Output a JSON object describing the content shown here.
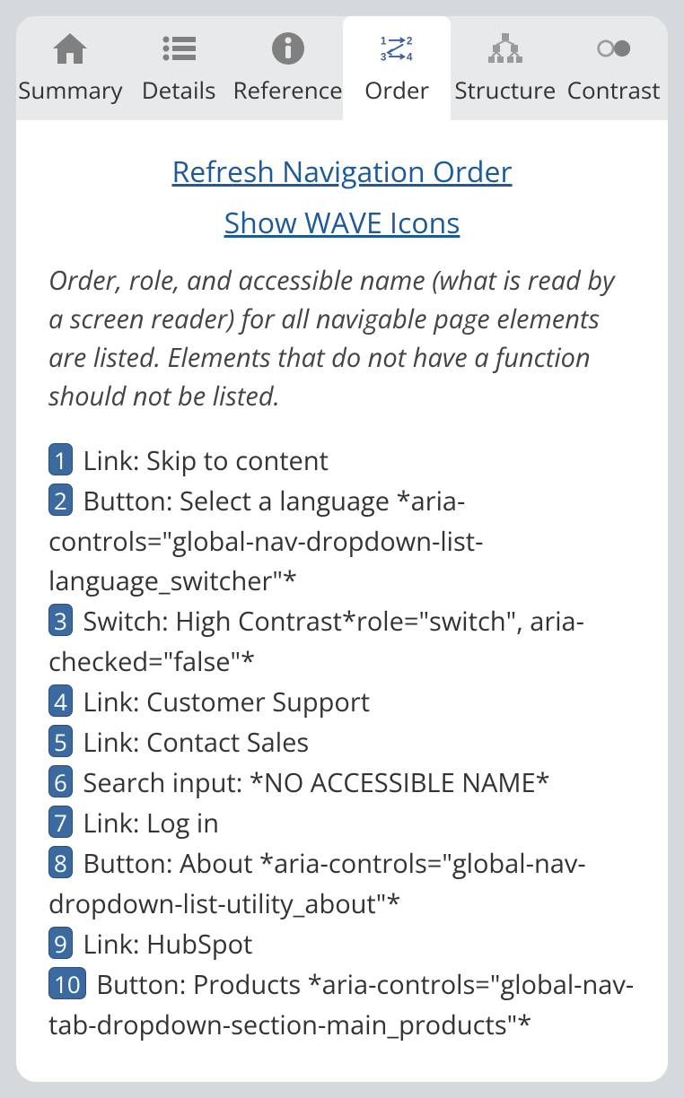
{
  "tabs": [
    {
      "id": "summary",
      "label": "Summary"
    },
    {
      "id": "details",
      "label": "Details"
    },
    {
      "id": "reference",
      "label": "Reference"
    },
    {
      "id": "order",
      "label": "Order"
    },
    {
      "id": "structure",
      "label": "Structure"
    },
    {
      "id": "contrast",
      "label": "Contrast"
    }
  ],
  "active_tab": "order",
  "links": {
    "refresh": "Refresh Navigation Order",
    "showIcons": "Show WAVE Icons"
  },
  "description": "Order, role, and accessible name (what is read by a screen reader) for all navigable page elements are listed. Elements that do not have a function should not be listed.",
  "order": [
    {
      "n": "1",
      "text": "Link: Skip to content"
    },
    {
      "n": "2",
      "text": "Button: Select a language *aria-controls=\"global-nav-dropdown-list-language_switcher\"*"
    },
    {
      "n": "3",
      "text": "Switch: High Contrast*role=\"switch\", aria-checked=\"false\"*"
    },
    {
      "n": "4",
      "text": "Link: Customer Support"
    },
    {
      "n": "5",
      "text": "Link: Contact Sales"
    },
    {
      "n": "6",
      "text": "Search input: *NO ACCESSIBLE NAME*"
    },
    {
      "n": "7",
      "text": "Link: Log in"
    },
    {
      "n": "8",
      "text": "Button: About *aria-controls=\"global-nav-dropdown-list-utility_about\"*"
    },
    {
      "n": "9",
      "text": "Link: HubSpot"
    },
    {
      "n": "10",
      "text": "Button: Products *aria-controls=\"global-nav-tab-dropdown-section-main_products\"*"
    }
  ]
}
